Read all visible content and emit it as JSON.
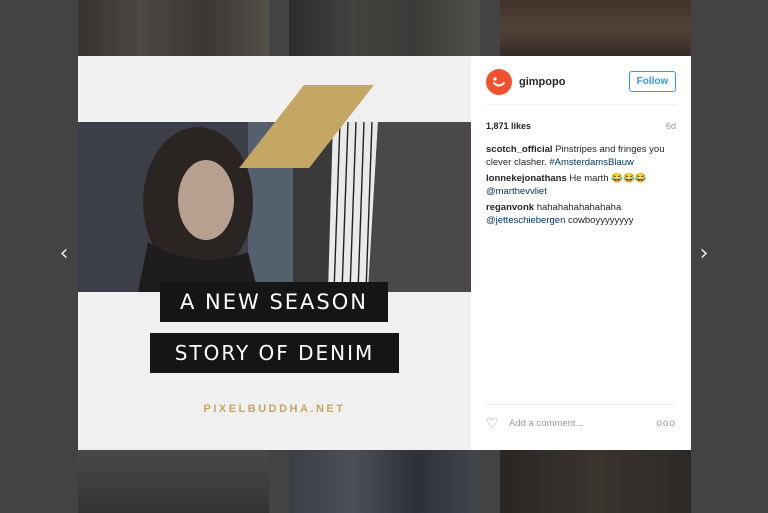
{
  "navigation": {
    "prev_icon": "chevron-left-icon",
    "prev_glyph": "‹",
    "next_icon": "chevron-right-icon",
    "next_glyph": "›"
  },
  "post": {
    "headline_line1": "A NEW SEASON",
    "headline_line2": "STORY OF DENIM",
    "brand_url": "PIXELBUDDHA.NET",
    "accent_color": "#c4a763"
  },
  "header": {
    "username": "gimpopo",
    "follow_label": "Follow",
    "avatar_color": "#f0522f"
  },
  "stats": {
    "likes": "1,871 likes",
    "age": "6d"
  },
  "comments": [
    {
      "user": "scotch_official",
      "text": "Pinstripes and fringes you clever clasher.",
      "link": "#AmsterdamsBlauw"
    },
    {
      "user": "lonnekejonathans",
      "text": "He marth",
      "emoji": "😂😂😂",
      "link": "@marthevvliet"
    },
    {
      "user": "reganvonk",
      "text": "hahahahahahahaha",
      "link": "@jetteschiebergen",
      "text2": "cowboyyyyyyyy"
    }
  ],
  "footer": {
    "add_comment_placeholder": "Add a comment...",
    "more_label": "ooo"
  }
}
